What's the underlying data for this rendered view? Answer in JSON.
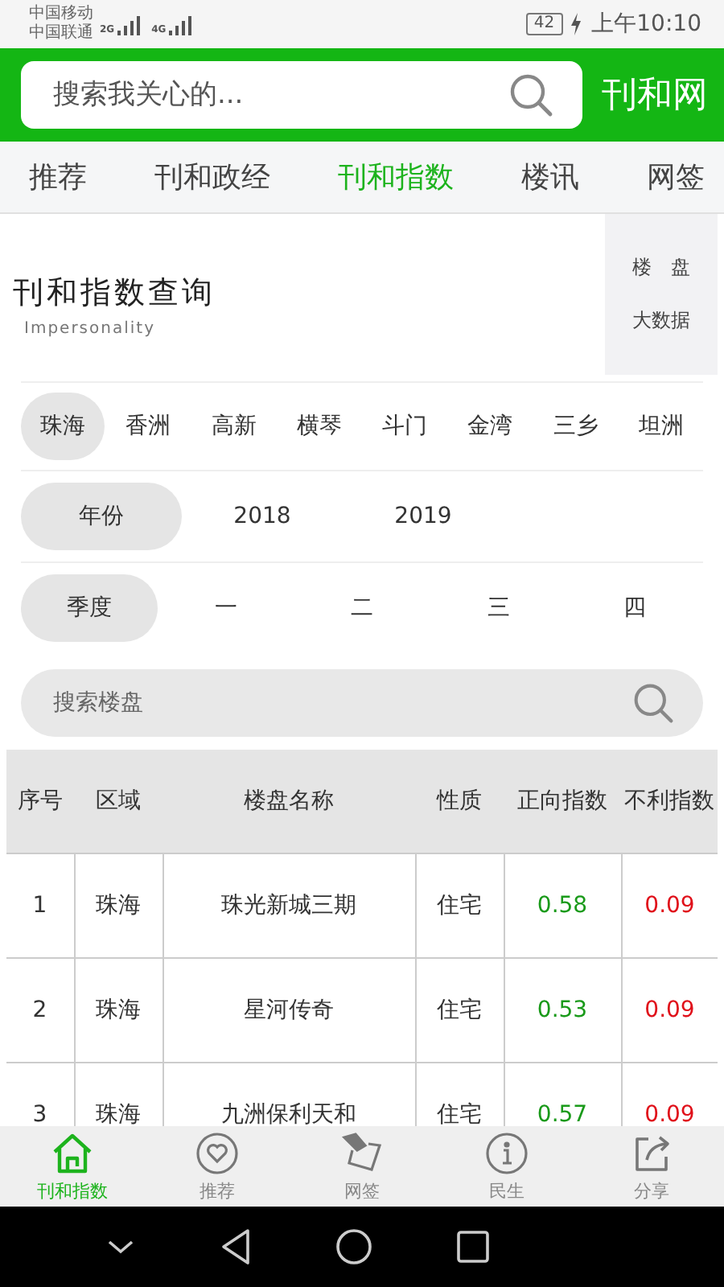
{
  "status_bar": {
    "carriers": [
      "中国移动",
      "中国联通"
    ],
    "networks": [
      "2G",
      "4G"
    ],
    "battery": "42",
    "time": "上午10:10"
  },
  "header": {
    "search": {
      "placeholder": "搜索我关心的..."
    },
    "brand": "刊和网"
  },
  "tabs": [
    {
      "label": "推荐",
      "selected": false
    },
    {
      "label": "刊和政经",
      "selected": false
    },
    {
      "label": "刊和指数",
      "selected": true
    },
    {
      "label": "楼讯",
      "selected": false
    },
    {
      "label": "网签",
      "selected": false
    }
  ],
  "query": {
    "title": "刊和指数查询",
    "subtitle": "Impersonality",
    "side_link": [
      "楼　盘",
      "大数据"
    ]
  },
  "regions": [
    {
      "label": "珠海",
      "selected": true
    },
    {
      "label": "香洲",
      "selected": false
    },
    {
      "label": "高新",
      "selected": false
    },
    {
      "label": "横琴",
      "selected": false
    },
    {
      "label": "斗门",
      "selected": false
    },
    {
      "label": "金湾",
      "selected": false
    },
    {
      "label": "三乡",
      "selected": false
    },
    {
      "label": "坦洲",
      "selected": false
    }
  ],
  "year_filter": {
    "label": "年份",
    "options": [
      {
        "label": "2018",
        "selected": false
      },
      {
        "label": "2019",
        "selected": false
      }
    ]
  },
  "quarter_filter": {
    "label": "季度",
    "options": [
      {
        "label": "一",
        "selected": false
      },
      {
        "label": "二",
        "selected": false
      },
      {
        "label": "三",
        "selected": false
      },
      {
        "label": "四",
        "selected": false
      }
    ]
  },
  "project_search": {
    "placeholder": "搜索楼盘"
  },
  "table": {
    "columns": [
      "序号",
      "区域",
      "楼盘名称",
      "性质",
      "正向指数",
      "不利指数"
    ],
    "rows": [
      [
        "1",
        "珠海",
        "珠光新城三期",
        "住宅",
        "0.58",
        "0.09"
      ],
      [
        "2",
        "珠海",
        "星河传奇",
        "住宅",
        "0.53",
        "0.09"
      ],
      [
        "3",
        "珠海",
        "九洲保利天和",
        "住宅",
        "0.57",
        "0.09"
      ]
    ]
  },
  "bottom_nav": [
    {
      "label": "刊和指数",
      "selected": true
    },
    {
      "label": "推荐",
      "selected": false
    },
    {
      "label": "网签",
      "selected": false
    },
    {
      "label": "民生",
      "selected": false
    },
    {
      "label": "分享",
      "selected": false
    }
  ]
}
